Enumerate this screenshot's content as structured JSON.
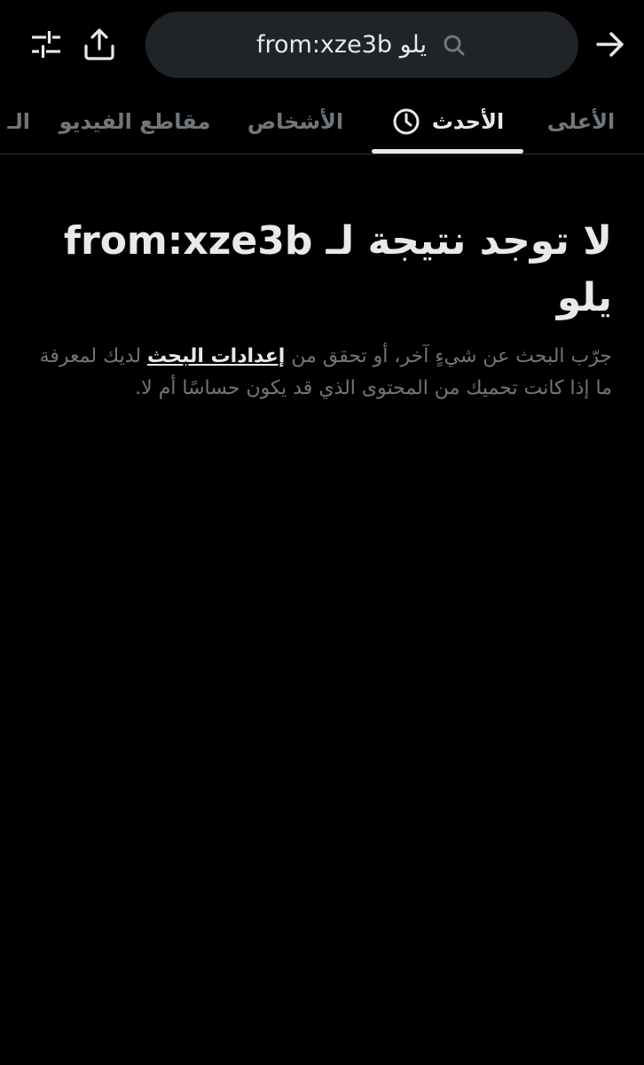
{
  "header": {
    "search_query": "from:xze3b يلو",
    "icons": {
      "back": "arrow-right-icon",
      "share": "share-upload-icon",
      "filters": "sliders-icon",
      "search": "search-icon"
    }
  },
  "tabs": [
    {
      "label": "الأعلى",
      "active": false
    },
    {
      "label": "الأحدث",
      "active": true,
      "icon": "clock-icon"
    },
    {
      "label": "الأشخاص",
      "active": false
    },
    {
      "label": "مقاطع الفيديو",
      "active": false
    },
    {
      "label": "الـ",
      "active": false
    }
  ],
  "empty_state": {
    "headline": "لا توجد نتيجة لـ from:xze3b يلو",
    "text_before": "جرّب البحث عن شيءٍ آخر، أو تحقق من ",
    "link": "إعدادات البحث",
    "text_after": " لديك لمعرفة ما إذا كانت تحميك من المحتوى الذي قد يكون حساسًا أم لا."
  },
  "colors": {
    "background": "#000000",
    "primary_text": "#e7e9ea",
    "secondary_text": "#71767b",
    "search_bg": "#202327",
    "divider": "#2f3336"
  }
}
